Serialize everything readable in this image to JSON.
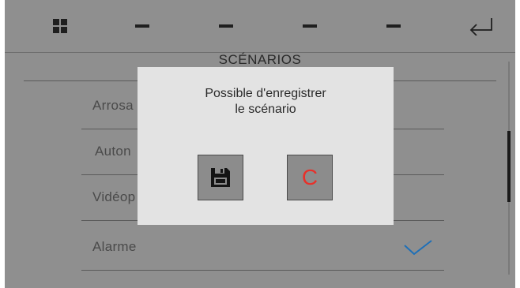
{
  "toolbar": {
    "icons": [
      "grid-icon",
      "dash-icon",
      "dash-icon",
      "dash-icon",
      "dash-icon",
      "return-arrow-icon"
    ]
  },
  "list": {
    "title": "SCÉNARIOS",
    "items": [
      {
        "label": "Arrosa"
      },
      {
        "label": "Auton"
      },
      {
        "label": "Vidéop"
      },
      {
        "label": "Alarme",
        "checked": true
      }
    ]
  },
  "dialog": {
    "message_line1": "Possible d'enregistrer",
    "message_line2": "le scénario",
    "save_icon": "floppy-disk-icon",
    "cancel_label": "C"
  },
  "colors": {
    "background": "#8f8f8f",
    "dialog": "#e3e3e3",
    "button": "#8c8c8c",
    "cancel_text": "#e8302a",
    "check": "#1d6fb8"
  }
}
